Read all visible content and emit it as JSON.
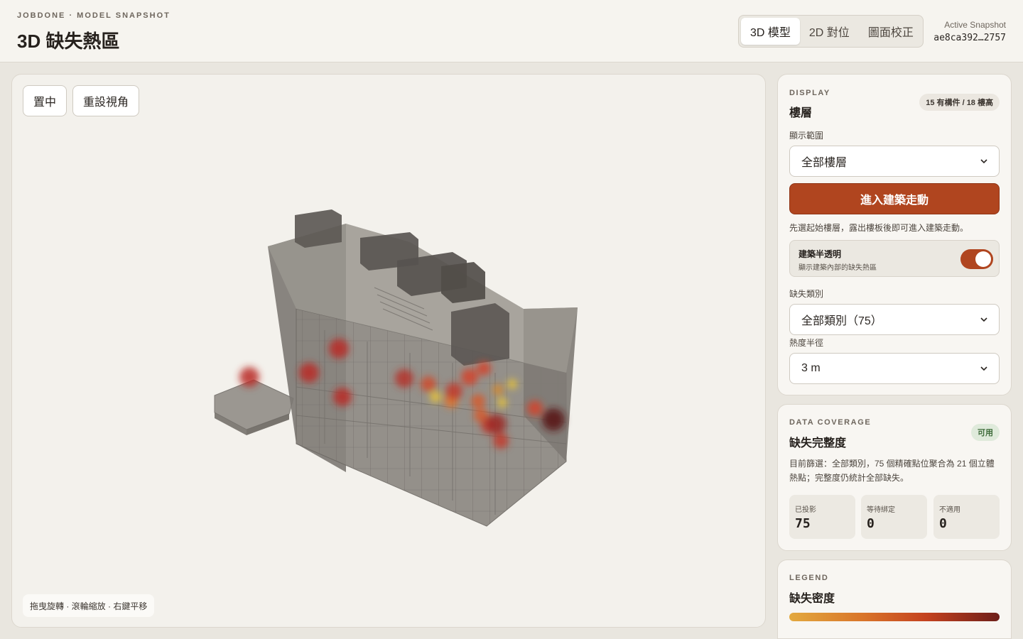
{
  "header": {
    "kicker": "JOBDONE · MODEL SNAPSHOT",
    "title": "3D 缺失熱區",
    "tabs": [
      {
        "label": "3D 模型",
        "active": true
      },
      {
        "label": "2D 對位",
        "active": false
      },
      {
        "label": "圖面校正",
        "active": false
      }
    ],
    "snapshot_label": "Active Snapshot",
    "snapshot_id": "ae8ca392…2757"
  },
  "viewer": {
    "center_button": "置中",
    "reset_view_button": "重設視角",
    "hint": "拖曳旋轉 · 滾輪縮放 · 右鍵平移"
  },
  "display": {
    "kicker": "DISPLAY",
    "title": "樓層",
    "badge": "15 有構件 / 18 樓高",
    "range_label": "顯示範圍",
    "range_value": "全部樓層",
    "walk_button": "進入建築走動",
    "walk_note": "先選起始樓層，露出樓板後即可進入建築走動。",
    "transparency_title": "建築半透明",
    "transparency_sub": "顯示建築內部的缺失熱區",
    "transparency_on": true,
    "category_label": "缺失類別",
    "category_value": "全部類別（75）",
    "radius_label": "熱度半徑",
    "radius_value": "3 m"
  },
  "coverage": {
    "kicker": "DATA COVERAGE",
    "title": "缺失完整度",
    "badge": "可用",
    "description": "目前篩選：全部類別，75 個精確點位聚合為 21 個立體熱點；完整度仍統計全部缺失。",
    "stats": [
      {
        "label": "已投影",
        "value": "75"
      },
      {
        "label": "等待綁定",
        "value": "0"
      },
      {
        "label": "不適用",
        "value": "0"
      }
    ]
  },
  "legend": {
    "kicker": "LEGEND",
    "title": "缺失密度"
  },
  "colors": {
    "accent": "#b0451f",
    "heat_low": "#e3a93f",
    "heat_high": "#6e1f1a",
    "badge_green_bg": "#dfeadb",
    "badge_green_text": "#3e6b3a"
  },
  "hotspots": [
    {
      "intensity": 0.8
    },
    {
      "intensity": 0.8
    },
    {
      "intensity": 0.8
    },
    {
      "intensity": 0.8
    },
    {
      "intensity": 0.7
    },
    {
      "intensity": 0.6
    },
    {
      "intensity": 0.3
    },
    {
      "intensity": 0.5
    },
    {
      "intensity": 0.7
    },
    {
      "intensity": 0.4
    },
    {
      "intensity": 0.3
    },
    {
      "intensity": 0.3
    },
    {
      "intensity": 0.5
    },
    {
      "intensity": 0.6
    },
    {
      "intensity": 0.8
    },
    {
      "intensity": 0.7
    },
    {
      "intensity": 0.6
    },
    {
      "intensity": 0.7
    },
    {
      "intensity": 1.0
    },
    {
      "intensity": 0.6
    },
    {
      "intensity": 0.2
    }
  ]
}
